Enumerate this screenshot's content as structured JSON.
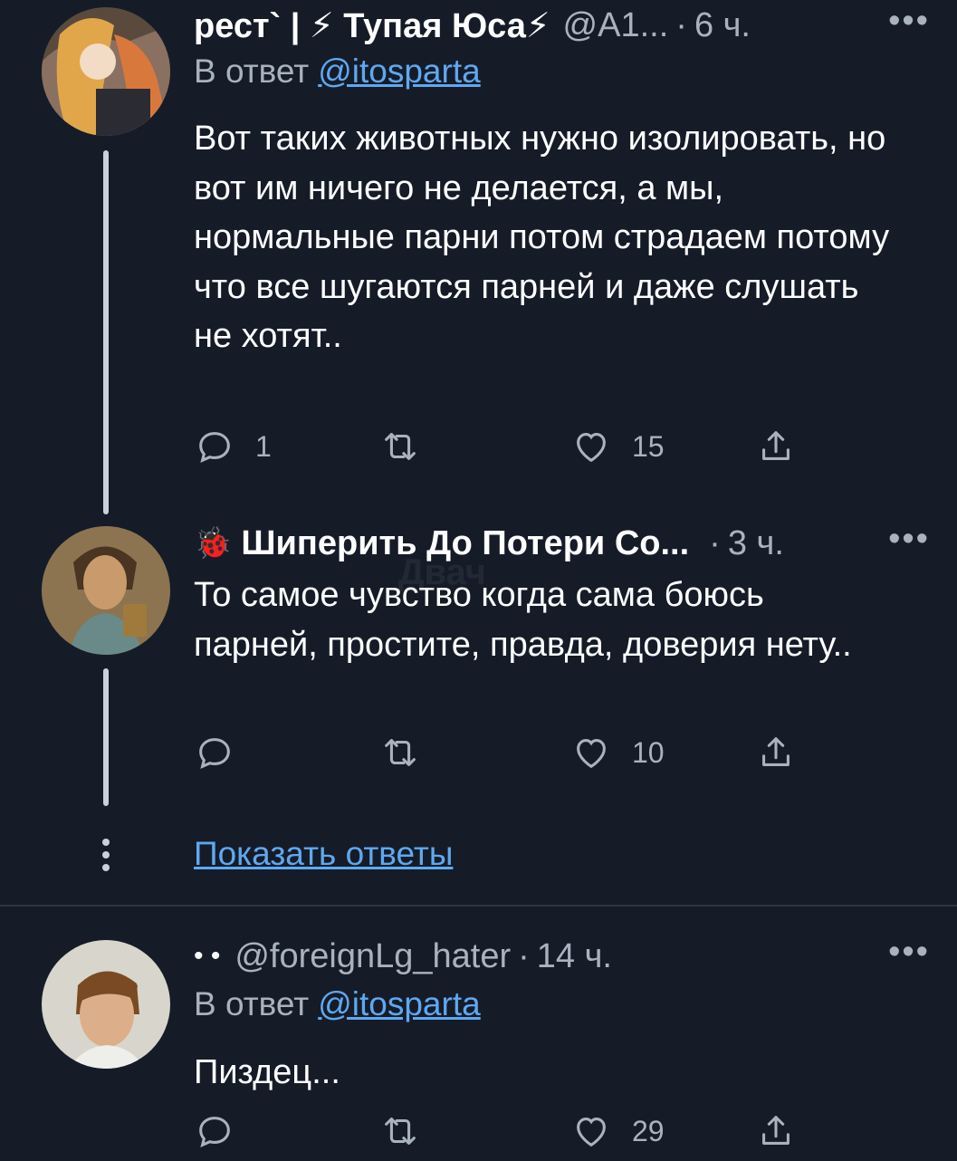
{
  "colors": {
    "background": "#151c28",
    "text": "#ffffff",
    "secondary": "#a9b3bf",
    "link": "#5fa8f0",
    "thread_line": "#c9d1dc"
  },
  "tweets": [
    {
      "name": "рест` | ⚡ Тупая Юса⚡",
      "handle": "@A1...",
      "separator": "·",
      "time": "6 ч.",
      "more": "•••",
      "reply_prefix": "В ответ",
      "reply_mention": "@itosparta",
      "text": "Вот таких животных нужно изолировать, но вот им ничего не делается, а мы, нормальные парни потом страдаем потому что все шугаются парней и даже слушать не хотят..",
      "actions": {
        "replies": "1",
        "retweets": "",
        "likes": "15"
      }
    },
    {
      "badge": "🐞",
      "name": "Шиперить До Потери Со...",
      "separator": "·",
      "time": "3 ч.",
      "more": "•••",
      "text": "То самое чувство когда сама боюсь парней, простите, правда, доверия нету..",
      "actions": {
        "replies": "",
        "retweets": "",
        "likes": "10"
      }
    },
    {
      "name": "• •",
      "handle": "@foreignLg_hater",
      "separator": "·",
      "time": "14 ч.",
      "more": "•••",
      "reply_prefix": "В ответ",
      "reply_mention": "@itosparta",
      "text": "Пиздец...",
      "actions": {
        "replies": "",
        "retweets": "",
        "likes": "29"
      }
    }
  ],
  "show_replies": "Показать ответы",
  "watermark": "Двач",
  "icons": [
    "reply-icon",
    "retweet-icon",
    "like-icon",
    "share-icon",
    "more-icon",
    "thread-dots-icon"
  ]
}
